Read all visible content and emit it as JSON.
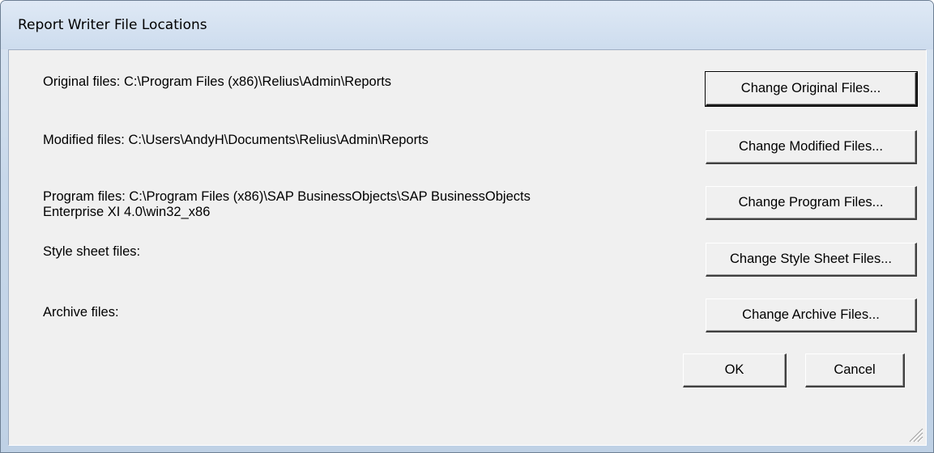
{
  "window": {
    "title": "Report Writer File Locations"
  },
  "rows": [
    {
      "label_line1": "Original files: C:\\Program Files (x86)\\Relius\\Admin\\Reports",
      "label_line2": "",
      "button": "Change Original Files..."
    },
    {
      "label_line1": "Modified files: C:\\Users\\AndyH\\Documents\\Relius\\Admin\\Reports",
      "label_line2": "",
      "button": "Change Modified Files..."
    },
    {
      "label_line1": "Program files: C:\\Program Files (x86)\\SAP BusinessObjects\\SAP BusinessObjects",
      "label_line2": "Enterprise XI 4.0\\win32_x86",
      "button": "Change Program Files..."
    },
    {
      "label_line1": "Style sheet files:",
      "label_line2": "",
      "button": "Change Style Sheet Files..."
    },
    {
      "label_line1": "Archive files:",
      "label_line2": "",
      "button": "Change Archive Files..."
    }
  ],
  "footer": {
    "ok_label": "OK",
    "cancel_label": "Cancel"
  },
  "icons": {
    "resize_grip": "resize-grip-icon"
  }
}
